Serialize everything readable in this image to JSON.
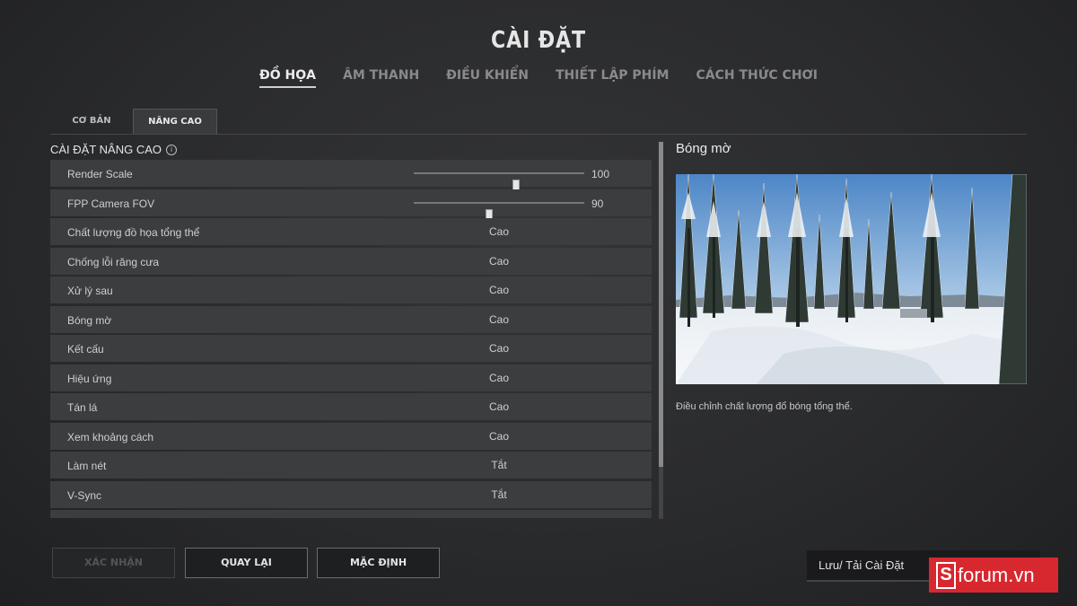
{
  "header": {
    "title": "CÀI ĐẶT"
  },
  "tabs": [
    {
      "label": "ĐỒ HỌA",
      "active": true
    },
    {
      "label": "ÂM THANH",
      "active": false
    },
    {
      "label": "ĐIỀU KHIỂN",
      "active": false
    },
    {
      "label": "THIẾT LẬP PHÍM",
      "active": false
    },
    {
      "label": "CÁCH THỨC CHƠI",
      "active": false
    }
  ],
  "subtabs": [
    {
      "label": "CƠ BẢN",
      "active": false
    },
    {
      "label": "NÂNG CAO",
      "active": true
    }
  ],
  "section": {
    "title": "CÀI ĐẶT NÂNG CAO",
    "info_icon": "i"
  },
  "sliders": [
    {
      "label": "Render Scale",
      "value": "100",
      "position": 0.6
    },
    {
      "label": "FPP Camera FOV",
      "value": "90",
      "position": 0.44
    }
  ],
  "rows": [
    {
      "label": "Chất lượng đồ họa tổng thể",
      "value": "Cao"
    },
    {
      "label": "Chống lỗi răng cưa",
      "value": "Cao"
    },
    {
      "label": "Xử lý sau",
      "value": "Cao"
    },
    {
      "label": "Bóng mờ",
      "value": "Cao"
    },
    {
      "label": "Kết cấu",
      "value": "Cao"
    },
    {
      "label": "Hiệu ứng",
      "value": "Cao"
    },
    {
      "label": "Tán lá",
      "value": "Cao"
    },
    {
      "label": "Xem khoảng cách",
      "value": "Cao"
    },
    {
      "label": "Làm nét",
      "value": "Tắt"
    },
    {
      "label": "V-Sync",
      "value": "Tắt"
    }
  ],
  "detail": {
    "title": "Bóng mờ",
    "description": "Điều chỉnh chất lượng đổ bóng tổng thể."
  },
  "buttons": {
    "confirm": "XÁC NHẬN",
    "back": "QUAY LẠI",
    "default": "MẶC ĐỊNH"
  },
  "saveload": {
    "label": "Lưu/ Tải Cài Đặt"
  },
  "watermark": {
    "s": "S",
    "text": "forum.vn"
  },
  "colors": {
    "accent_red": "#d7282f",
    "background": "#2a2b2d"
  }
}
